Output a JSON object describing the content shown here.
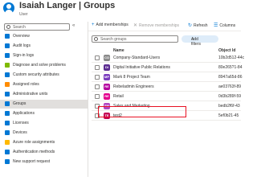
{
  "header": {
    "title": "Isaiah Langer | Groups",
    "subtitle": "User"
  },
  "sidebar": {
    "search_placeholder": "Search",
    "collapse_glyph": "«",
    "items": [
      {
        "label": "Overview",
        "color": "#0078d4"
      },
      {
        "label": "Audit logs",
        "color": "#0078d4"
      },
      {
        "label": "Sign-in logs",
        "color": "#0078d4"
      },
      {
        "label": "Diagnose and solve problems",
        "color": "#7fba00"
      },
      {
        "label": "Custom security attributes",
        "color": "#0078d4"
      },
      {
        "label": "Assigned roles",
        "color": "#ff8c00"
      },
      {
        "label": "Administrative units",
        "color": "#0078d4"
      },
      {
        "label": "Groups",
        "color": "#0078d4",
        "selected": true
      },
      {
        "label": "Applications",
        "color": "#0078d4"
      },
      {
        "label": "Licenses",
        "color": "#0078d4"
      },
      {
        "label": "Devices",
        "color": "#0078d4"
      },
      {
        "label": "Azure role assignments",
        "color": "#ffb900"
      },
      {
        "label": "Authentication methods",
        "color": "#0078d4"
      },
      {
        "label": "New support request",
        "color": "#0078d4"
      }
    ]
  },
  "toolbar": {
    "add_memberships": "Add memberships",
    "remove_memberships": "Remove memberships",
    "refresh": "Refresh",
    "columns": "Columns"
  },
  "groups_search_placeholder": "Search groups",
  "add_filters": "Add filters",
  "table": {
    "headers": {
      "name": "Name",
      "object_id": "Object Id"
    },
    "rows": [
      {
        "initials": "CO",
        "name": "Company-Standard-Users",
        "id": "10b2d512-44c",
        "color": "#8a8a8a"
      },
      {
        "initials": "DI",
        "name": "Digital Initiative Public Relations",
        "id": "80e265?1-84",
        "color": "#5c2d91"
      },
      {
        "initials": "MP",
        "name": "Mark 8 Project Team",
        "id": "8947a65d-86",
        "color": "#7a3cbd"
      },
      {
        "initials": "RE",
        "name": "Rebeladmin Engineers",
        "id": "ae03763f-89",
        "color": "#b4009e"
      },
      {
        "initials": "RE",
        "name": "Retail",
        "id": "0d3b289f-59",
        "color": "#e3008c"
      },
      {
        "initials": "SM",
        "name": "Sales and Marketing",
        "id": "bedb2f6f-43",
        "color": "#b146c2"
      },
      {
        "initials": "TE",
        "name": "test2",
        "id": "5ef0b21-45",
        "color": "#c30052"
      }
    ]
  }
}
